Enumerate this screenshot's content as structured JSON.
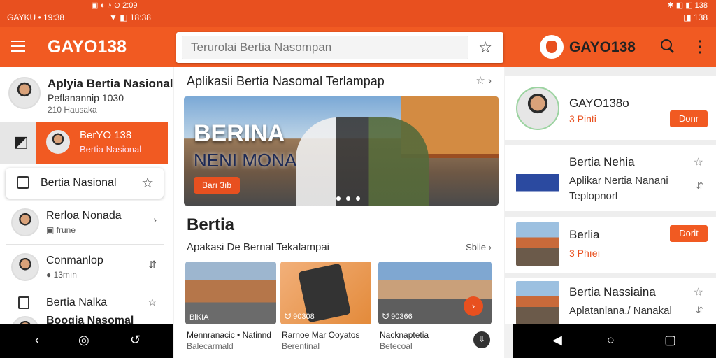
{
  "statusbar": {
    "left": "GAYKU • 19:38",
    "center": "▼ ◧ 18:38",
    "center_top": "▣ ◐ ◔ ⊙ 2:09",
    "right": "✱ ◧ ◧ 138",
    "right_bottom": "◨ 138"
  },
  "appbar": {
    "brand": "GAYO138",
    "search_placeholder": "Terurolai Bertia Nasompan",
    "brand_right": "GAYO138"
  },
  "left": {
    "profile_title": "Aplyia Bertia Nasional",
    "profile_sub": "Peflanannip 1030",
    "profile_sub2": "210 Hausaka",
    "selected_title": "BerYO 138",
    "selected_sub": "Bertia Nasional",
    "chip_label": "Bertia Nasional",
    "rows": [
      {
        "title": "Rerloa Nonada",
        "sub": "▣ frune"
      },
      {
        "title": "Conmanlop",
        "sub": "● 13mın"
      },
      {
        "title": "Bertia Nalka",
        "sub": ""
      },
      {
        "title": "Boogia Nasomal",
        "sub": ""
      }
    ]
  },
  "main": {
    "header": "Aplikasii Bertia Nasomal Terlampap",
    "hero_title": "BERINA",
    "hero_sub": "NENI MONA",
    "hero_button": "Barı 3ıb",
    "section_title": "Bertia",
    "section_sub": "Apakasi De Bernal Tekalampai",
    "see_all": "Sblie",
    "cards": [
      {
        "badge": "BiKIA",
        "caption": "Mennranacic • Natinnd",
        "caption2": "Balecarmald"
      },
      {
        "badge": "ᗢ 90308",
        "caption": "Rarnoe Mar Ooyatos",
        "caption2": "Berentinal"
      },
      {
        "badge": "ᗢ 90366",
        "caption": "Nacknaptetia",
        "caption2": "Betecoal"
      }
    ]
  },
  "right": {
    "profile_title": "GAYO138o",
    "profile_sub": "3 Pinti",
    "profile_button": "Donr",
    "items": [
      {
        "title": "Bertia Nehia",
        "sub": "Aplikar Nertia Nanani",
        "sub2": "Teplopnorl",
        "meta": "",
        "button": ""
      },
      {
        "title": "Berlia",
        "sub": "",
        "sub2": "",
        "meta": "3 Phıeı",
        "button": "Dorit"
      },
      {
        "title": "Bertia Nassiaina",
        "sub": "Aplatanlana,/ Nanakal",
        "sub2": "",
        "meta": "",
        "button": ""
      }
    ]
  },
  "colors": {
    "brand": "#f15a22",
    "statusbar": "#e8501f"
  }
}
